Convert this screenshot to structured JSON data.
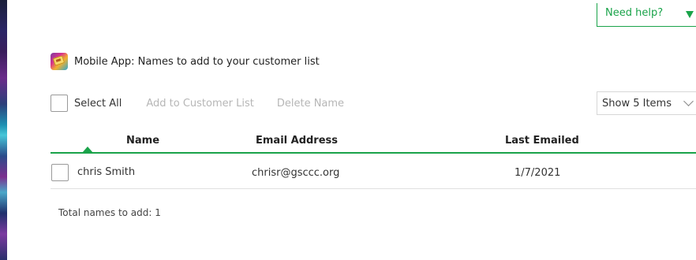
{
  "header": {
    "help_label": "Need help?",
    "title": "Mobile App: Names to add to your customer list"
  },
  "toolbar": {
    "select_all_label": "Select All",
    "add_label": "Add to Customer List",
    "delete_label": "Delete Name",
    "show_items_value": "Show 5 Items"
  },
  "table": {
    "columns": [
      "Name",
      "Email Address",
      "Last Emailed"
    ],
    "rows": [
      {
        "name": "chris Smith",
        "email": "chrisr@gsccc.org",
        "last_emailed": "1/7/2021"
      }
    ]
  },
  "footer": {
    "total_text": "Total names to add: 1"
  },
  "colors": {
    "accent": "#1aa34a",
    "disabled_text": "#b6b6b6",
    "divider": "#e0e0e0"
  },
  "icons": {
    "help": "chevron-down-icon",
    "title": "app-icon",
    "select": "chevron-down-icon"
  }
}
